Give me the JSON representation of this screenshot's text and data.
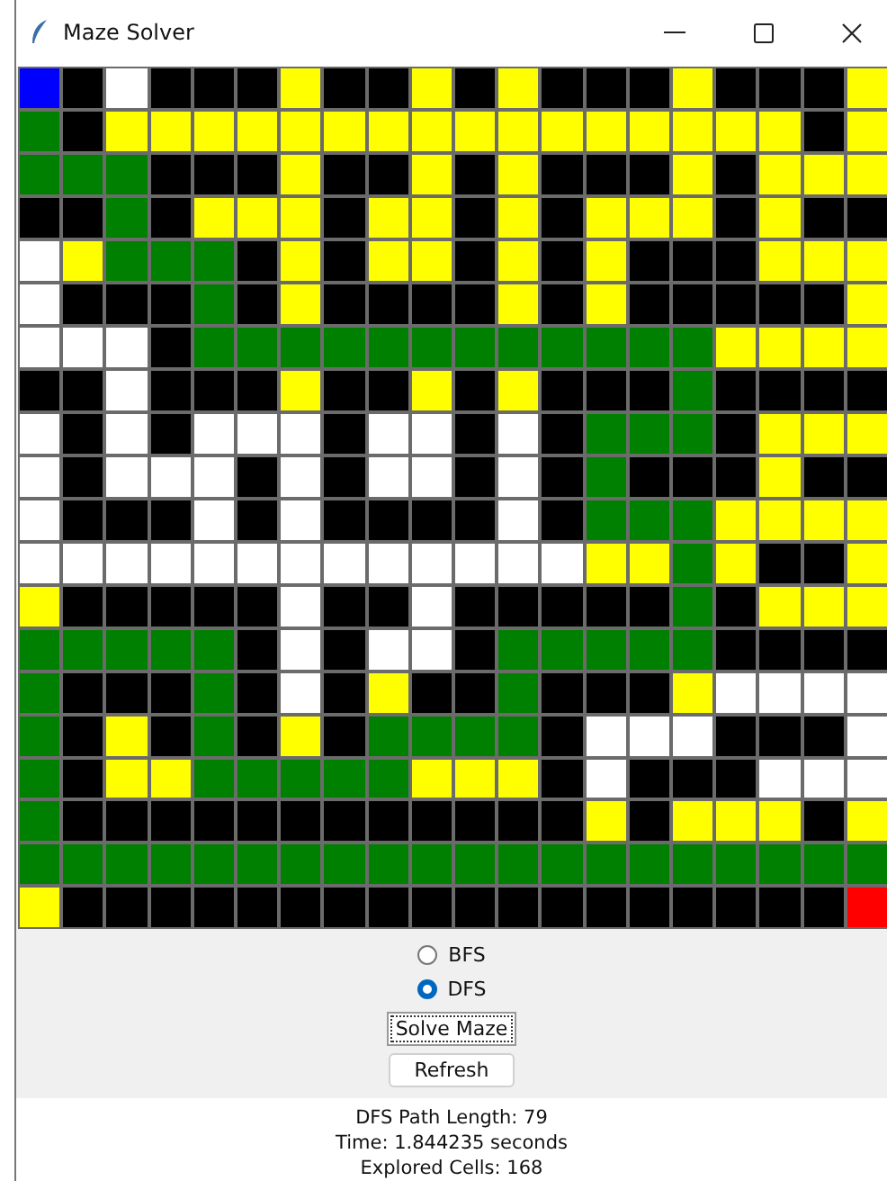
{
  "window": {
    "title": "Maze Solver"
  },
  "maze": {
    "rows": [
      {
        "cells": [
          {
            "kind": "start"
          },
          {
            "kind": "wall"
          },
          {
            "kind": "open"
          },
          {
            "kind": "wall"
          },
          {
            "kind": "wall"
          },
          {
            "kind": "wall"
          },
          {
            "kind": "seen"
          },
          {
            "kind": "wall"
          },
          {
            "kind": "wall"
          },
          {
            "kind": "seen"
          },
          {
            "kind": "wall"
          },
          {
            "kind": "seen"
          },
          {
            "kind": "wall"
          },
          {
            "kind": "wall"
          },
          {
            "kind": "wall"
          },
          {
            "kind": "seen"
          },
          {
            "kind": "wall"
          },
          {
            "kind": "wall"
          },
          {
            "kind": "wall"
          },
          {
            "kind": "seen"
          }
        ]
      },
      {
        "cells": [
          {
            "kind": "path"
          },
          {
            "kind": "wall"
          },
          {
            "kind": "seen"
          },
          {
            "kind": "seen"
          },
          {
            "kind": "seen"
          },
          {
            "kind": "seen"
          },
          {
            "kind": "seen"
          },
          {
            "kind": "seen"
          },
          {
            "kind": "seen"
          },
          {
            "kind": "seen"
          },
          {
            "kind": "seen"
          },
          {
            "kind": "seen"
          },
          {
            "kind": "seen"
          },
          {
            "kind": "seen"
          },
          {
            "kind": "seen"
          },
          {
            "kind": "seen"
          },
          {
            "kind": "seen"
          },
          {
            "kind": "seen"
          },
          {
            "kind": "wall"
          },
          {
            "kind": "seen"
          }
        ]
      },
      {
        "cells": [
          {
            "kind": "path"
          },
          {
            "kind": "path"
          },
          {
            "kind": "path"
          },
          {
            "kind": "wall"
          },
          {
            "kind": "wall"
          },
          {
            "kind": "wall"
          },
          {
            "kind": "seen"
          },
          {
            "kind": "wall"
          },
          {
            "kind": "wall"
          },
          {
            "kind": "seen"
          },
          {
            "kind": "wall"
          },
          {
            "kind": "seen"
          },
          {
            "kind": "wall"
          },
          {
            "kind": "wall"
          },
          {
            "kind": "wall"
          },
          {
            "kind": "seen"
          },
          {
            "kind": "wall"
          },
          {
            "kind": "seen"
          },
          {
            "kind": "seen"
          },
          {
            "kind": "seen"
          }
        ]
      },
      {
        "cells": [
          {
            "kind": "wall"
          },
          {
            "kind": "wall"
          },
          {
            "kind": "path"
          },
          {
            "kind": "wall"
          },
          {
            "kind": "seen"
          },
          {
            "kind": "seen"
          },
          {
            "kind": "seen"
          },
          {
            "kind": "wall"
          },
          {
            "kind": "seen"
          },
          {
            "kind": "seen"
          },
          {
            "kind": "wall"
          },
          {
            "kind": "seen"
          },
          {
            "kind": "wall"
          },
          {
            "kind": "seen"
          },
          {
            "kind": "seen"
          },
          {
            "kind": "seen"
          },
          {
            "kind": "wall"
          },
          {
            "kind": "seen"
          },
          {
            "kind": "wall"
          },
          {
            "kind": "wall"
          }
        ]
      },
      {
        "cells": [
          {
            "kind": "open"
          },
          {
            "kind": "seen"
          },
          {
            "kind": "path"
          },
          {
            "kind": "path"
          },
          {
            "kind": "path"
          },
          {
            "kind": "wall"
          },
          {
            "kind": "seen"
          },
          {
            "kind": "wall"
          },
          {
            "kind": "seen"
          },
          {
            "kind": "seen"
          },
          {
            "kind": "wall"
          },
          {
            "kind": "seen"
          },
          {
            "kind": "wall"
          },
          {
            "kind": "seen"
          },
          {
            "kind": "wall"
          },
          {
            "kind": "wall"
          },
          {
            "kind": "wall"
          },
          {
            "kind": "seen"
          },
          {
            "kind": "seen"
          },
          {
            "kind": "seen"
          }
        ]
      },
      {
        "cells": [
          {
            "kind": "open"
          },
          {
            "kind": "wall"
          },
          {
            "kind": "wall"
          },
          {
            "kind": "wall"
          },
          {
            "kind": "path"
          },
          {
            "kind": "wall"
          },
          {
            "kind": "seen"
          },
          {
            "kind": "wall"
          },
          {
            "kind": "wall"
          },
          {
            "kind": "wall"
          },
          {
            "kind": "wall"
          },
          {
            "kind": "seen"
          },
          {
            "kind": "wall"
          },
          {
            "kind": "seen"
          },
          {
            "kind": "wall"
          },
          {
            "kind": "wall"
          },
          {
            "kind": "wall"
          },
          {
            "kind": "wall"
          },
          {
            "kind": "wall"
          },
          {
            "kind": "seen"
          }
        ]
      },
      {
        "cells": [
          {
            "kind": "open"
          },
          {
            "kind": "open"
          },
          {
            "kind": "open"
          },
          {
            "kind": "wall"
          },
          {
            "kind": "path"
          },
          {
            "kind": "path"
          },
          {
            "kind": "path"
          },
          {
            "kind": "path"
          },
          {
            "kind": "path"
          },
          {
            "kind": "path"
          },
          {
            "kind": "path"
          },
          {
            "kind": "path"
          },
          {
            "kind": "path"
          },
          {
            "kind": "path"
          },
          {
            "kind": "path"
          },
          {
            "kind": "path"
          },
          {
            "kind": "seen"
          },
          {
            "kind": "seen"
          },
          {
            "kind": "seen"
          },
          {
            "kind": "seen"
          }
        ]
      },
      {
        "cells": [
          {
            "kind": "wall"
          },
          {
            "kind": "wall"
          },
          {
            "kind": "open"
          },
          {
            "kind": "wall"
          },
          {
            "kind": "wall"
          },
          {
            "kind": "wall"
          },
          {
            "kind": "seen"
          },
          {
            "kind": "wall"
          },
          {
            "kind": "wall"
          },
          {
            "kind": "seen"
          },
          {
            "kind": "wall"
          },
          {
            "kind": "seen"
          },
          {
            "kind": "wall"
          },
          {
            "kind": "wall"
          },
          {
            "kind": "wall"
          },
          {
            "kind": "path"
          },
          {
            "kind": "wall"
          },
          {
            "kind": "wall"
          },
          {
            "kind": "wall"
          },
          {
            "kind": "wall"
          }
        ]
      },
      {
        "cells": [
          {
            "kind": "open"
          },
          {
            "kind": "wall"
          },
          {
            "kind": "open"
          },
          {
            "kind": "wall"
          },
          {
            "kind": "open"
          },
          {
            "kind": "open"
          },
          {
            "kind": "open"
          },
          {
            "kind": "wall"
          },
          {
            "kind": "open"
          },
          {
            "kind": "open"
          },
          {
            "kind": "wall"
          },
          {
            "kind": "open"
          },
          {
            "kind": "wall"
          },
          {
            "kind": "path"
          },
          {
            "kind": "path"
          },
          {
            "kind": "path"
          },
          {
            "kind": "wall"
          },
          {
            "kind": "seen"
          },
          {
            "kind": "seen"
          },
          {
            "kind": "seen"
          }
        ]
      },
      {
        "cells": [
          {
            "kind": "open"
          },
          {
            "kind": "wall"
          },
          {
            "kind": "open"
          },
          {
            "kind": "open"
          },
          {
            "kind": "open"
          },
          {
            "kind": "wall"
          },
          {
            "kind": "open"
          },
          {
            "kind": "wall"
          },
          {
            "kind": "open"
          },
          {
            "kind": "open"
          },
          {
            "kind": "wall"
          },
          {
            "kind": "open"
          },
          {
            "kind": "wall"
          },
          {
            "kind": "path"
          },
          {
            "kind": "wall"
          },
          {
            "kind": "wall"
          },
          {
            "kind": "wall"
          },
          {
            "kind": "seen"
          },
          {
            "kind": "wall"
          },
          {
            "kind": "wall"
          }
        ]
      },
      {
        "cells": [
          {
            "kind": "open"
          },
          {
            "kind": "wall"
          },
          {
            "kind": "wall"
          },
          {
            "kind": "wall"
          },
          {
            "kind": "open"
          },
          {
            "kind": "wall"
          },
          {
            "kind": "open"
          },
          {
            "kind": "wall"
          },
          {
            "kind": "wall"
          },
          {
            "kind": "wall"
          },
          {
            "kind": "wall"
          },
          {
            "kind": "open"
          },
          {
            "kind": "wall"
          },
          {
            "kind": "path"
          },
          {
            "kind": "path"
          },
          {
            "kind": "path"
          },
          {
            "kind": "seen"
          },
          {
            "kind": "seen"
          },
          {
            "kind": "seen"
          },
          {
            "kind": "seen"
          }
        ]
      },
      {
        "cells": [
          {
            "kind": "open"
          },
          {
            "kind": "open"
          },
          {
            "kind": "open"
          },
          {
            "kind": "open"
          },
          {
            "kind": "open"
          },
          {
            "kind": "open"
          },
          {
            "kind": "open"
          },
          {
            "kind": "open"
          },
          {
            "kind": "open"
          },
          {
            "kind": "open"
          },
          {
            "kind": "open"
          },
          {
            "kind": "open"
          },
          {
            "kind": "open"
          },
          {
            "kind": "seen"
          },
          {
            "kind": "seen"
          },
          {
            "kind": "path"
          },
          {
            "kind": "seen"
          },
          {
            "kind": "wall"
          },
          {
            "kind": "wall"
          },
          {
            "kind": "seen"
          }
        ]
      },
      {
        "cells": [
          {
            "kind": "seen"
          },
          {
            "kind": "wall"
          },
          {
            "kind": "wall"
          },
          {
            "kind": "wall"
          },
          {
            "kind": "wall"
          },
          {
            "kind": "wall"
          },
          {
            "kind": "open"
          },
          {
            "kind": "wall"
          },
          {
            "kind": "wall"
          },
          {
            "kind": "open"
          },
          {
            "kind": "wall"
          },
          {
            "kind": "wall"
          },
          {
            "kind": "wall"
          },
          {
            "kind": "wall"
          },
          {
            "kind": "wall"
          },
          {
            "kind": "path"
          },
          {
            "kind": "wall"
          },
          {
            "kind": "seen"
          },
          {
            "kind": "seen"
          },
          {
            "kind": "seen"
          }
        ]
      },
      {
        "cells": [
          {
            "kind": "path"
          },
          {
            "kind": "path"
          },
          {
            "kind": "path"
          },
          {
            "kind": "path"
          },
          {
            "kind": "path"
          },
          {
            "kind": "wall"
          },
          {
            "kind": "open"
          },
          {
            "kind": "wall"
          },
          {
            "kind": "open"
          },
          {
            "kind": "open"
          },
          {
            "kind": "wall"
          },
          {
            "kind": "path"
          },
          {
            "kind": "path"
          },
          {
            "kind": "path"
          },
          {
            "kind": "path"
          },
          {
            "kind": "path"
          },
          {
            "kind": "wall"
          },
          {
            "kind": "wall"
          },
          {
            "kind": "wall"
          },
          {
            "kind": "wall"
          }
        ]
      },
      {
        "cells": [
          {
            "kind": "path"
          },
          {
            "kind": "wall"
          },
          {
            "kind": "wall"
          },
          {
            "kind": "wall"
          },
          {
            "kind": "path"
          },
          {
            "kind": "wall"
          },
          {
            "kind": "open"
          },
          {
            "kind": "wall"
          },
          {
            "kind": "seen"
          },
          {
            "kind": "wall"
          },
          {
            "kind": "wall"
          },
          {
            "kind": "path"
          },
          {
            "kind": "wall"
          },
          {
            "kind": "wall"
          },
          {
            "kind": "wall"
          },
          {
            "kind": "seen"
          },
          {
            "kind": "open"
          },
          {
            "kind": "open"
          },
          {
            "kind": "open"
          },
          {
            "kind": "open"
          }
        ]
      },
      {
        "cells": [
          {
            "kind": "path"
          },
          {
            "kind": "wall"
          },
          {
            "kind": "seen"
          },
          {
            "kind": "wall"
          },
          {
            "kind": "path"
          },
          {
            "kind": "wall"
          },
          {
            "kind": "seen"
          },
          {
            "kind": "wall"
          },
          {
            "kind": "path"
          },
          {
            "kind": "path"
          },
          {
            "kind": "path"
          },
          {
            "kind": "path"
          },
          {
            "kind": "wall"
          },
          {
            "kind": "open"
          },
          {
            "kind": "open"
          },
          {
            "kind": "open"
          },
          {
            "kind": "wall"
          },
          {
            "kind": "wall"
          },
          {
            "kind": "wall"
          },
          {
            "kind": "open"
          }
        ]
      },
      {
        "cells": [
          {
            "kind": "path"
          },
          {
            "kind": "wall"
          },
          {
            "kind": "seen"
          },
          {
            "kind": "seen"
          },
          {
            "kind": "path"
          },
          {
            "kind": "path"
          },
          {
            "kind": "path"
          },
          {
            "kind": "path"
          },
          {
            "kind": "path"
          },
          {
            "kind": "seen"
          },
          {
            "kind": "seen"
          },
          {
            "kind": "seen"
          },
          {
            "kind": "wall"
          },
          {
            "kind": "open"
          },
          {
            "kind": "wall"
          },
          {
            "kind": "wall"
          },
          {
            "kind": "wall"
          },
          {
            "kind": "open"
          },
          {
            "kind": "open"
          },
          {
            "kind": "open"
          }
        ]
      },
      {
        "cells": [
          {
            "kind": "path"
          },
          {
            "kind": "wall"
          },
          {
            "kind": "wall"
          },
          {
            "kind": "wall"
          },
          {
            "kind": "wall"
          },
          {
            "kind": "wall"
          },
          {
            "kind": "wall"
          },
          {
            "kind": "wall"
          },
          {
            "kind": "wall"
          },
          {
            "kind": "wall"
          },
          {
            "kind": "wall"
          },
          {
            "kind": "wall"
          },
          {
            "kind": "wall"
          },
          {
            "kind": "seen"
          },
          {
            "kind": "wall"
          },
          {
            "kind": "seen"
          },
          {
            "kind": "seen"
          },
          {
            "kind": "seen"
          },
          {
            "kind": "wall"
          },
          {
            "kind": "seen"
          }
        ]
      },
      {
        "cells": [
          {
            "kind": "path"
          },
          {
            "kind": "path"
          },
          {
            "kind": "path"
          },
          {
            "kind": "path"
          },
          {
            "kind": "path"
          },
          {
            "kind": "path"
          },
          {
            "kind": "path"
          },
          {
            "kind": "path"
          },
          {
            "kind": "path"
          },
          {
            "kind": "path"
          },
          {
            "kind": "path"
          },
          {
            "kind": "path"
          },
          {
            "kind": "path"
          },
          {
            "kind": "path"
          },
          {
            "kind": "path"
          },
          {
            "kind": "path"
          },
          {
            "kind": "path"
          },
          {
            "kind": "path"
          },
          {
            "kind": "path"
          },
          {
            "kind": "path"
          }
        ]
      },
      {
        "cells": [
          {
            "kind": "seen"
          },
          {
            "kind": "wall"
          },
          {
            "kind": "wall"
          },
          {
            "kind": "wall"
          },
          {
            "kind": "wall"
          },
          {
            "kind": "wall"
          },
          {
            "kind": "wall"
          },
          {
            "kind": "wall"
          },
          {
            "kind": "wall"
          },
          {
            "kind": "wall"
          },
          {
            "kind": "wall"
          },
          {
            "kind": "wall"
          },
          {
            "kind": "wall"
          },
          {
            "kind": "wall"
          },
          {
            "kind": "wall"
          },
          {
            "kind": "wall"
          },
          {
            "kind": "wall"
          },
          {
            "kind": "wall"
          },
          {
            "kind": "wall"
          },
          {
            "kind": "goal"
          }
        ]
      }
    ]
  },
  "algorithms": [
    {
      "label": "BFS",
      "selected": false
    },
    {
      "label": "DFS",
      "selected": true
    }
  ],
  "buttons": [
    {
      "label": "Solve Maze",
      "focused": true
    },
    {
      "label": "Refresh",
      "focused": false
    }
  ],
  "results": [
    "DFS Path Length: 79",
    "Time: 1.844235 seconds",
    "Explored Cells: 168"
  ]
}
